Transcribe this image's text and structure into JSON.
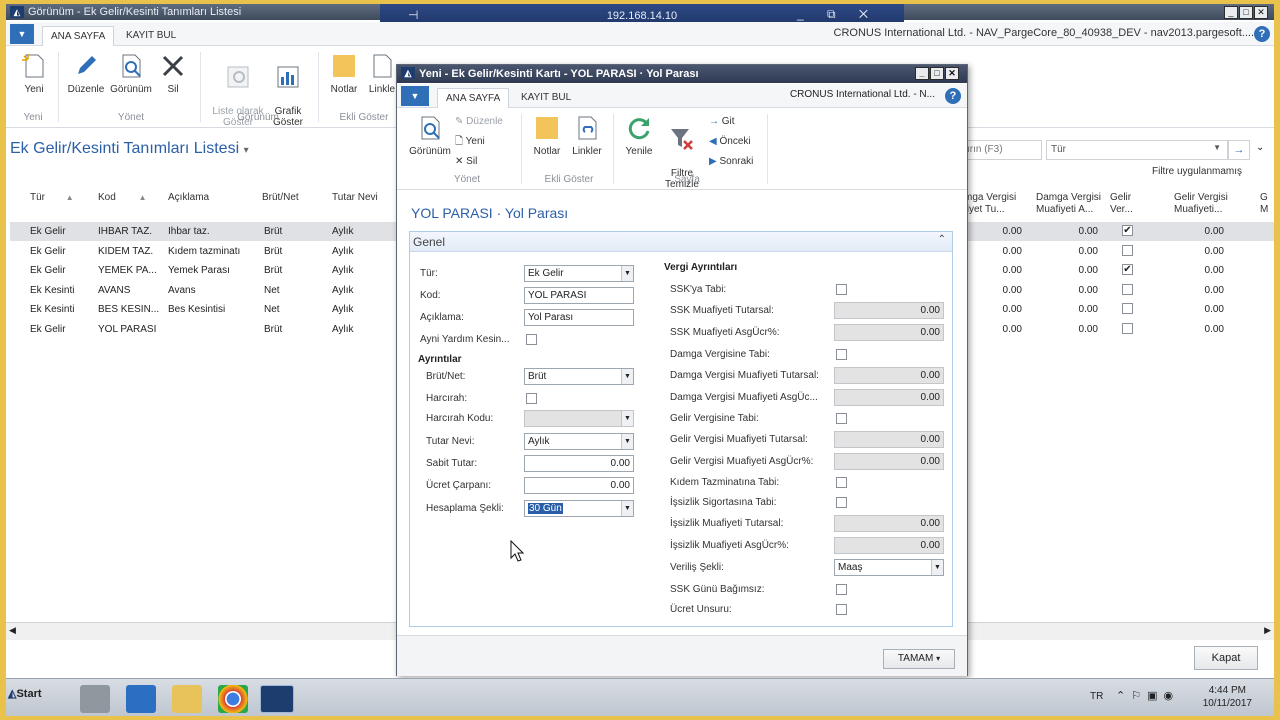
{
  "main_window": {
    "title": "Görünüm - Ek Gelir/Kesinti Tanımları Listesi",
    "company": "CRONUS International Ltd. - NAV_PargeCore_80_40938_DEV - nav2013.pargesoft....",
    "tabs": [
      "ANA SAYFA",
      "KAYIT BUL"
    ],
    "ribbon": {
      "yeni": "Yeni",
      "duzenle": "Düzenle",
      "gorunum": "Görünüm",
      "sil": "Sil",
      "liste_olarak_goster": "Liste olarak\nGöster",
      "grafik_goster": "Grafik\nGöster",
      "notlar": "Notlar",
      "linkler": "Linkle",
      "group_yeni": "Yeni",
      "group_yonet": "Yönet",
      "group_gorunum": "Görünüm",
      "group_ekli_goster": "Ekli Göster"
    },
    "page_title": "Ek Gelir/Kesinti Tanımları Listesi",
    "search_placeholder": "ırın (F3)",
    "filter_field": "Tür",
    "filter_status": "Filtre uygulanmamış",
    "columns": {
      "tur": "Tür",
      "kod": "Kod",
      "aciklama": "Açıklama",
      "brut_net": "Brüt/Net",
      "tutar_nevi": "Tutar Nevi",
      "damga_tutarsal": "mga Vergisi\nfiyet Tu...",
      "damga_asg": "Damga Vergisi\nMuafiyeti A...",
      "gelir_ver": "Gelir\nVer...",
      "gelir_muaf": "Gelir Vergisi\nMuafiyeti...",
      "extra": "G\nM"
    },
    "rows": [
      {
        "tur": "Ek Gelir",
        "kod": "IHBAR TAZ.",
        "aciklama": "Ihbar taz.",
        "brut_net": "Brüt",
        "tutar_nevi": "Aylık",
        "d1": "0.00",
        "d2": "0.00",
        "chk": "✔",
        "g": "0.00"
      },
      {
        "tur": "Ek Gelir",
        "kod": "KIDEM TAZ.",
        "aciklama": "Kıdem tazminatı",
        "brut_net": "Brüt",
        "tutar_nevi": "Aylık",
        "d1": "0.00",
        "d2": "0.00",
        "chk": "",
        "g": "0.00"
      },
      {
        "tur": "Ek Gelir",
        "kod": "YEMEK PA...",
        "aciklama": "Yemek Parası",
        "brut_net": "Brüt",
        "tutar_nevi": "Aylık",
        "d1": "0.00",
        "d2": "0.00",
        "chk": "✔",
        "g": "0.00"
      },
      {
        "tur": "Ek Kesinti",
        "kod": "AVANS",
        "aciklama": "Avans",
        "brut_net": "Net",
        "tutar_nevi": "Aylık",
        "d1": "0.00",
        "d2": "0.00",
        "chk": "",
        "g": "0.00"
      },
      {
        "tur": "Ek Kesinti",
        "kod": "BES KESIN...",
        "aciklama": "Bes Kesintisi",
        "brut_net": "Net",
        "tutar_nevi": "Aylık",
        "d1": "0.00",
        "d2": "0.00",
        "chk": "",
        "g": "0.00"
      },
      {
        "tur": "Ek Gelir",
        "kod": "YOL PARASI",
        "aciklama": "",
        "brut_net": "Brüt",
        "tutar_nevi": "Aylık",
        "d1": "0.00",
        "d2": "0.00",
        "chk": "",
        "g": "0.00"
      }
    ],
    "close_button": "Kapat"
  },
  "remote": {
    "ip": "192.168.14.10"
  },
  "dialog": {
    "title": "Yeni - Ek Gelir/Kesinti Kartı - YOL PARASI · Yol Parası",
    "company": "CRONUS International Ltd. - N...",
    "tabs": [
      "ANA SAYFA",
      "KAYIT BUL"
    ],
    "ribbon": {
      "gorunum": "Görünüm",
      "duzenle": "Düzenle",
      "yeni": "Yeni",
      "sil": "Sil",
      "notlar": "Notlar",
      "linkler": "Linkler",
      "yenile": "Yenile",
      "filtre_temizle": "Filtre\nTemizle",
      "git": "Git",
      "onceki": "Önceki",
      "sonraki": "Sonraki",
      "group_yonet": "Yönet",
      "group_ekli_goster": "Ekli Göster",
      "group_sayfa": "Sayfa"
    },
    "heading": "YOL PARASI · Yol Parası",
    "fasttab": "Genel",
    "left": {
      "tur_label": "Tür:",
      "tur_value": "Ek Gelir",
      "kod_label": "Kod:",
      "kod_value": "YOL PARASI",
      "aciklama_label": "Açıklama:",
      "aciklama_value": "Yol Parası",
      "ayni_yardim_label": "Ayni Yardım Kesin...",
      "ayrintilar": "Ayrıntılar",
      "brut_net_label": "Brüt/Net:",
      "brut_net_value": "Brüt",
      "harcirah_label": "Harcırah:",
      "harcirah_kodu_label": "Harcırah Kodu:",
      "tutar_nevi_label": "Tutar Nevi:",
      "tutar_nevi_value": "Aylık",
      "sabit_tutar_label": "Sabit Tutar:",
      "sabit_tutar_value": "0.00",
      "ucret_carpani_label": "Ücret Çarpanı:",
      "ucret_carpani_value": "0.00",
      "hesaplama_label": "Hesaplama Şekli:",
      "hesaplama_value": "30 Gün"
    },
    "right": {
      "header": "Vergi Ayrıntıları",
      "ssk_tabi": "SSK'ya Tabi:",
      "ssk_muaf_tutarsal": "SSK Muafiyeti Tutarsal:",
      "ssk_muaf_tutarsal_value": "0.00",
      "ssk_muaf_asg": "SSK Muafiyeti AsgÜcr%:",
      "ssk_muaf_asg_value": "0.00",
      "damga_tabi": "Damga Vergisine Tabi:",
      "damga_muaf_tutarsal": "Damga Vergisi Muafiyeti Tutarsal:",
      "damga_muaf_tutarsal_value": "0.00",
      "damga_muaf_asg": "Damga Vergisi Muafiyeti AsgÜc...",
      "damga_muaf_asg_value": "0.00",
      "gelir_tabi": "Gelir Vergisine Tabi:",
      "gelir_muaf_tutarsal": "Gelir Vergisi Muafiyeti Tutarsal:",
      "gelir_muaf_tutarsal_value": "0.00",
      "gelir_muaf_asg": "Gelir Vergisi Muafiyeti AsgÜcr%:",
      "gelir_muaf_asg_value": "0.00",
      "kidem_tabi": "Kıdem Tazminatına Tabi:",
      "issizlik_tabi": "İşsizlik Sigortasına Tabi:",
      "issizlik_tutarsal": "İşsizlik Muafiyeti Tutarsal:",
      "issizlik_tutarsal_value": "0.00",
      "issizlik_asg": "İşsizlik Muafiyeti AsgÜcr%:",
      "issizlik_asg_value": "0.00",
      "veris_sekli": "Veriliş Şekli:",
      "veris_sekli_value": "Maaş",
      "ssk_gunu": "SSK Günü Bağımsız:",
      "ucret_unsuru": "Ücret Unsuru:"
    },
    "ok_button": "TAMAM"
  },
  "taskbar": {
    "start": "Start",
    "lang": "TR",
    "time": "4:44 PM",
    "date": "10/11/2017"
  }
}
